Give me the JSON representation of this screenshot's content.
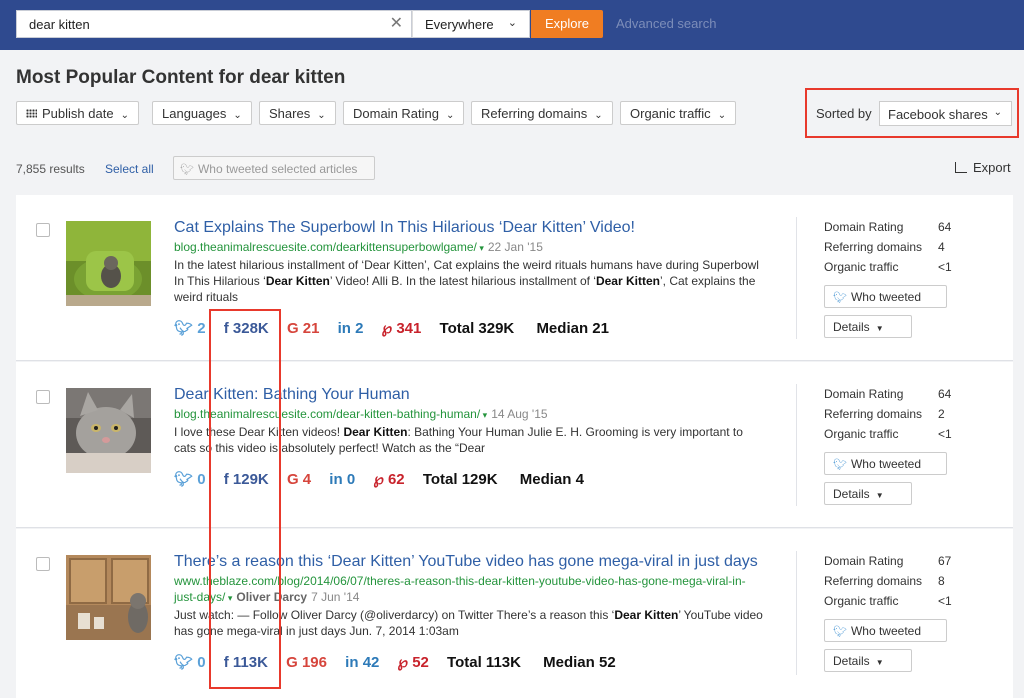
{
  "search": {
    "query": "dear kitten",
    "scope": "Everywhere",
    "explore_label": "Explore",
    "advanced_label": "Advanced search"
  },
  "page_title": "Most Popular Content for dear kitten",
  "filters": [
    "Publish date",
    "Languages",
    "Shares",
    "Domain Rating",
    "Referring domains",
    "Organic traffic"
  ],
  "sort": {
    "label": "Sorted by",
    "value": "Facebook shares"
  },
  "results": {
    "count": "7,855 results",
    "select_all": "Select all",
    "who_tweeted_selected": "Who tweeted selected articles",
    "export": "Export"
  },
  "metric_labels": {
    "dr": "Domain Rating",
    "rd": "Referring domains",
    "ot": "Organic traffic"
  },
  "buttons": {
    "who_tweeted": "Who tweeted",
    "details": "Details"
  },
  "articles": [
    {
      "title": "Cat Explains The Superbowl In This Hilarious ‘Dear Kitten’ Video!",
      "url": "blog.theanimalrescuesite.com/dearkittensuperbowlgame/",
      "date": "22 Jan '15",
      "snippet_html": "In the latest hilarious installment of ‘Dear Kitten’, Cat explains the weird rituals humans have during Superbowl In This Hilarious ‘<b>Dear Kitten</b>’ Video! Alli B. In the latest hilarious installment of ‘<b>Dear Kitten</b>’, Cat explains the weird rituals",
      "stats": {
        "twitter": "2",
        "facebook": "328K",
        "google": "21",
        "linkedin": "2",
        "pinterest": "341",
        "total": "Total 329K",
        "median": "Median 21"
      },
      "domain_rating": "64",
      "referring_domains": "4",
      "organic_traffic": "<1"
    },
    {
      "title": "Dear Kitten: Bathing Your Human",
      "url": "blog.theanimalrescuesite.com/dear-kitten-bathing-human/",
      "date": "14 Aug '15",
      "snippet_html": "I love these Dear Kitten videos! <b>Dear Kitten</b>: Bathing Your Human Julie E. H. Grooming is very important to cats so this video is absolutely perfect! Watch as the “Dear",
      "stats": {
        "twitter": "0",
        "facebook": "129K",
        "google": "4",
        "linkedin": "0",
        "pinterest": "62",
        "total": "Total 129K",
        "median": "Median 4"
      },
      "domain_rating": "64",
      "referring_domains": "2",
      "organic_traffic": "<1"
    },
    {
      "title": "There’s a reason this ‘Dear Kitten’ YouTube video has gone mega-viral in just days",
      "url": "www.theblaze.com/blog/2014/06/07/theres-a-reason-this-dear-kitten-youtube-video-has-gone-mega-viral-in-just-days/",
      "author": "Oliver Darcy",
      "date": "7 Jun '14",
      "snippet_html": "Just watch: — Follow Oliver Darcy (@oliverdarcy) on Twitter There’s a reason this ‘<b>Dear Kitten</b>’ YouTube video has gone mega-viral in just days Jun. 7, 2014 1:03am",
      "stats": {
        "twitter": "0",
        "facebook": "113K",
        "google": "196",
        "linkedin": "42",
        "pinterest": "52",
        "total": "Total 113K",
        "median": "Median 52"
      },
      "domain_rating": "67",
      "referring_domains": "8",
      "organic_traffic": "<1"
    }
  ],
  "colors": {
    "topbar": "#2f4a8f",
    "explore": "#f07d22",
    "link": "#2f5fa6",
    "url": "#24943c",
    "highlight": "#e8392c"
  }
}
